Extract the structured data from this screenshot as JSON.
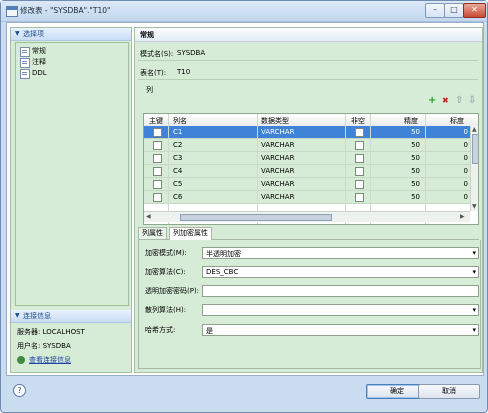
{
  "window": {
    "title": "修改表 - \"SYSDBA\".\"T10\"",
    "min": "–",
    "max": "□",
    "close": "✕"
  },
  "left": {
    "select_header": "选择项",
    "items": [
      {
        "label": "常规"
      },
      {
        "label": "注释"
      },
      {
        "label": "DDL"
      }
    ],
    "conn_header": "连接信息",
    "server": "服务器: LOCALHOST",
    "user": "用户名: SYSDBA",
    "view_conn": "查看连接信息"
  },
  "right": {
    "title": "常规",
    "schema_label": "模式名(S):",
    "schema_value": "SYSDBA",
    "table_label": "表名(T):",
    "table_value": "T10",
    "columns_label": "列",
    "icons": {
      "add": "+",
      "delete": "✖",
      "up": "⇧",
      "down": "⇩"
    },
    "grid": {
      "headers": [
        "主键",
        "列名",
        "数据类型",
        "非空",
        "精度",
        "标度"
      ],
      "rows": [
        {
          "name": "C1",
          "type": "VARCHAR",
          "precision": "50",
          "scale": "0"
        },
        {
          "name": "C2",
          "type": "VARCHAR",
          "precision": "50",
          "scale": "0"
        },
        {
          "name": "C3",
          "type": "VARCHAR",
          "precision": "50",
          "scale": "0"
        },
        {
          "name": "C4",
          "type": "VARCHAR",
          "precision": "50",
          "scale": "0"
        },
        {
          "name": "C5",
          "type": "VARCHAR",
          "precision": "50",
          "scale": "0"
        },
        {
          "name": "C6",
          "type": "VARCHAR",
          "precision": "50",
          "scale": "0"
        }
      ]
    },
    "tabs": [
      "列属性",
      "列加密属性"
    ],
    "props": {
      "enc_mode_label": "加密模式(M):",
      "enc_mode_value": "半透明加密",
      "enc_alg_label": "加密算法(C):",
      "enc_alg_value": "DES_CBC",
      "pwd_label": "透明加密密码(P):",
      "pwd_value": "",
      "hash_label": "散列算法(H):",
      "hash_value": "",
      "salt_label": "哈希方式:",
      "salt_value": "是"
    }
  },
  "footer": {
    "help": "?",
    "ok": "确定",
    "cancel": "取消"
  }
}
